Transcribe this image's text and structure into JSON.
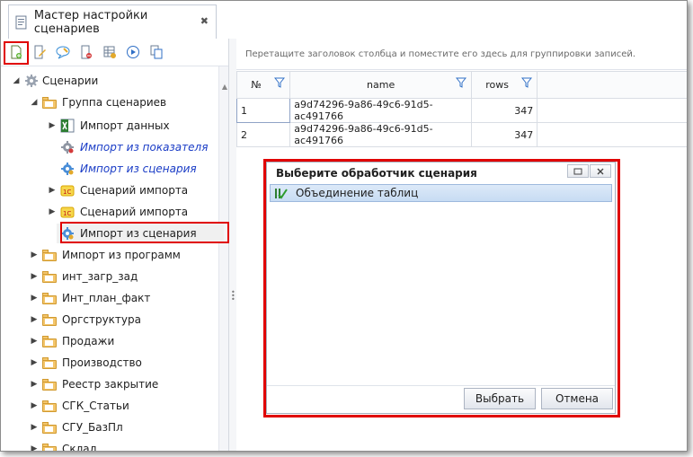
{
  "tab": {
    "title": "Мастер настройки сценариев",
    "close": "✖"
  },
  "toolbar": {
    "buttons": [
      "new-scenario",
      "edit",
      "comment",
      "delete",
      "settings",
      "run",
      "copy"
    ]
  },
  "tree": {
    "root": "Сценарии",
    "group": "Группа сценариев",
    "children": [
      {
        "label": "Импорт данных",
        "style": "normal",
        "icon": "excel"
      },
      {
        "label": "Импорт из показателя",
        "style": "italic",
        "icon": "gear-gray"
      },
      {
        "label": "Импорт из сценария",
        "style": "italic",
        "icon": "gear-blue"
      },
      {
        "label": "Сценарий импорта",
        "style": "normal",
        "icon": "1c"
      },
      {
        "label": "Сценарий импорта",
        "style": "normal",
        "icon": "1c"
      },
      {
        "label": "Импорт из сценария",
        "style": "normal",
        "icon": "gear-blue"
      }
    ],
    "folders": [
      "Импорт из программ",
      "инт_загр_зад",
      "Инт_план_факт",
      "Оргструктура",
      "Продажи",
      "Производство",
      "Реестр закрытие",
      "СГК_Статьи",
      "СГУ_БазПл",
      "Склад"
    ]
  },
  "grid": {
    "group_hint": "Перетащите заголовок столбца и поместите его здесь для группировки записей.",
    "columns": [
      "№",
      "name",
      "rows"
    ],
    "rows": [
      {
        "n": "1",
        "name": "a9d74296-9a86-49c6-91d5-ac491766",
        "rows": "347"
      },
      {
        "n": "2",
        "name": "a9d74296-9a86-49c6-91d5-ac491766",
        "rows": "347"
      }
    ]
  },
  "dialog": {
    "title": "Выберите обработчик сценария",
    "item": "Объединение таблиц",
    "ok": "Выбрать",
    "cancel": "Отмена"
  },
  "colors": {
    "accent_red": "#e00000",
    "selection": "#c7dcf3",
    "link_blue": "#1a3cc6"
  }
}
